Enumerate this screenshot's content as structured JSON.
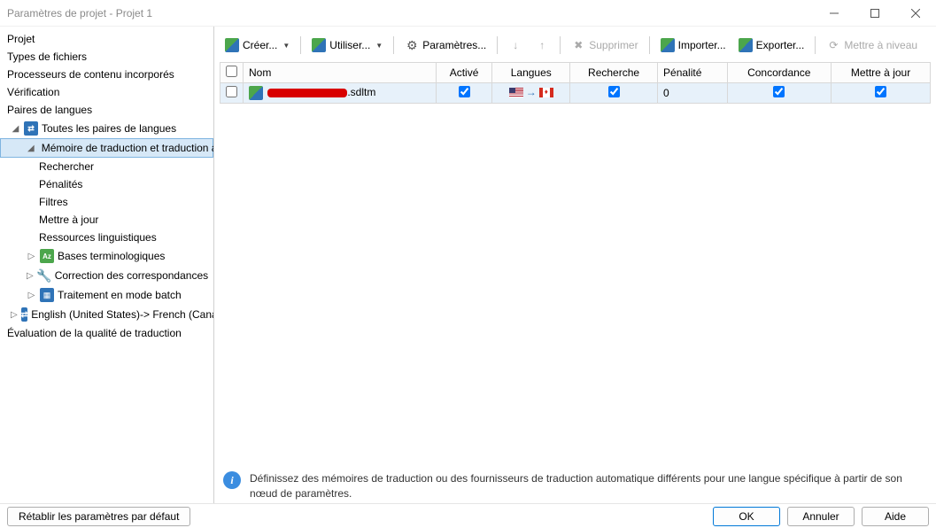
{
  "window": {
    "title": "Paramètres de projet - Projet 1"
  },
  "nav": {
    "projet": "Projet",
    "types_fichiers": "Types de fichiers",
    "processeurs": "Processeurs de contenu incorporés",
    "verification": "Vérification",
    "paires_langues": "Paires de langues",
    "toutes_paires": "Toutes les paires de langues",
    "memoire_trad": "Mémoire de traduction et traduction a",
    "rechercher": "Rechercher",
    "penalites": "Pénalités",
    "filtres": "Filtres",
    "mettre_a_jour": "Mettre à jour",
    "ressources_ling": "Ressources linguistiques",
    "bases_term": "Bases terminologiques",
    "correction_corr": "Correction des correspondances",
    "traitement_batch": "Traitement en mode batch",
    "lang_pair": "English (United States)-> French (Canada)",
    "eval_qualite": "Évaluation de la qualité de traduction"
  },
  "toolbar": {
    "creer": "Créer...",
    "utiliser": "Utiliser...",
    "parametres": "Paramètres...",
    "supprimer": "Supprimer",
    "importer": "Importer...",
    "exporter": "Exporter...",
    "mettre_niveau": "Mettre à niveau"
  },
  "grid": {
    "headers": {
      "nom": "Nom",
      "active": "Activé",
      "langues": "Langues",
      "recherche": "Recherche",
      "penalite": "Pénalité",
      "concordance": "Concordance",
      "maj": "Mettre à jour"
    },
    "rows": [
      {
        "name_suffix": ".sdltm",
        "active": true,
        "recherche": true,
        "penalite": "0",
        "concordance": true,
        "maj": true
      }
    ]
  },
  "info": {
    "text": "Définissez des mémoires de traduction ou des fournisseurs de traduction automatique différents pour une langue spécifique à partir de son nœud de paramètres."
  },
  "footer": {
    "reset": "Rétablir les paramètres par défaut",
    "ok": "OK",
    "annuler": "Annuler",
    "aide": "Aide"
  }
}
